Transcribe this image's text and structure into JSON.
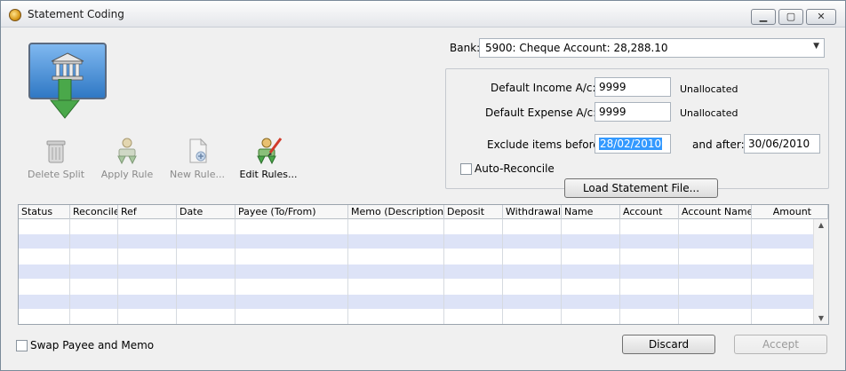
{
  "window": {
    "title": "Statement Coding",
    "title_icon": "app-icon",
    "minimize_glyph": "▁",
    "maximize_glyph": "▢",
    "close_glyph": "✕"
  },
  "toolbar": {
    "delete_split": "Delete Split",
    "apply_rule": "Apply Rule",
    "new_rule": "New Rule...",
    "edit_rules": "Edit Rules..."
  },
  "bank": {
    "label": "Bank:",
    "value": "5900: Cheque Account: 28,288.10",
    "arrow": "▼"
  },
  "defaults": {
    "income_label": "Default Income A/c:",
    "income_value": "9999",
    "income_status": "Unallocated",
    "expense_label": "Default Expense A/c:",
    "expense_value": "9999",
    "expense_status": "Unallocated"
  },
  "dates": {
    "exclude_label": "Exclude items before:",
    "exclude_value": "28/02/2010",
    "after_label": "and after:",
    "after_value": "30/06/2010"
  },
  "auto_reconcile": {
    "label": "Auto-Reconcile",
    "checked": false
  },
  "load_button": "Load Statement File...",
  "grid": {
    "columns": [
      "Status",
      "Reconcile",
      "Ref",
      "Date",
      "Payee (To/From)",
      "Memo (Description)",
      "Deposit",
      "Withdrawal",
      "Name",
      "Account",
      "Account Name",
      "Amount"
    ],
    "rows": [],
    "scroll_up": "▲",
    "scroll_down": "▼"
  },
  "footer": {
    "swap_label": "Swap Payee and Memo",
    "swap_checked": false,
    "discard": "Discard",
    "accept": "Accept"
  },
  "colors": {
    "alt_row": "#dde3f7",
    "selection": "#3399ff"
  }
}
